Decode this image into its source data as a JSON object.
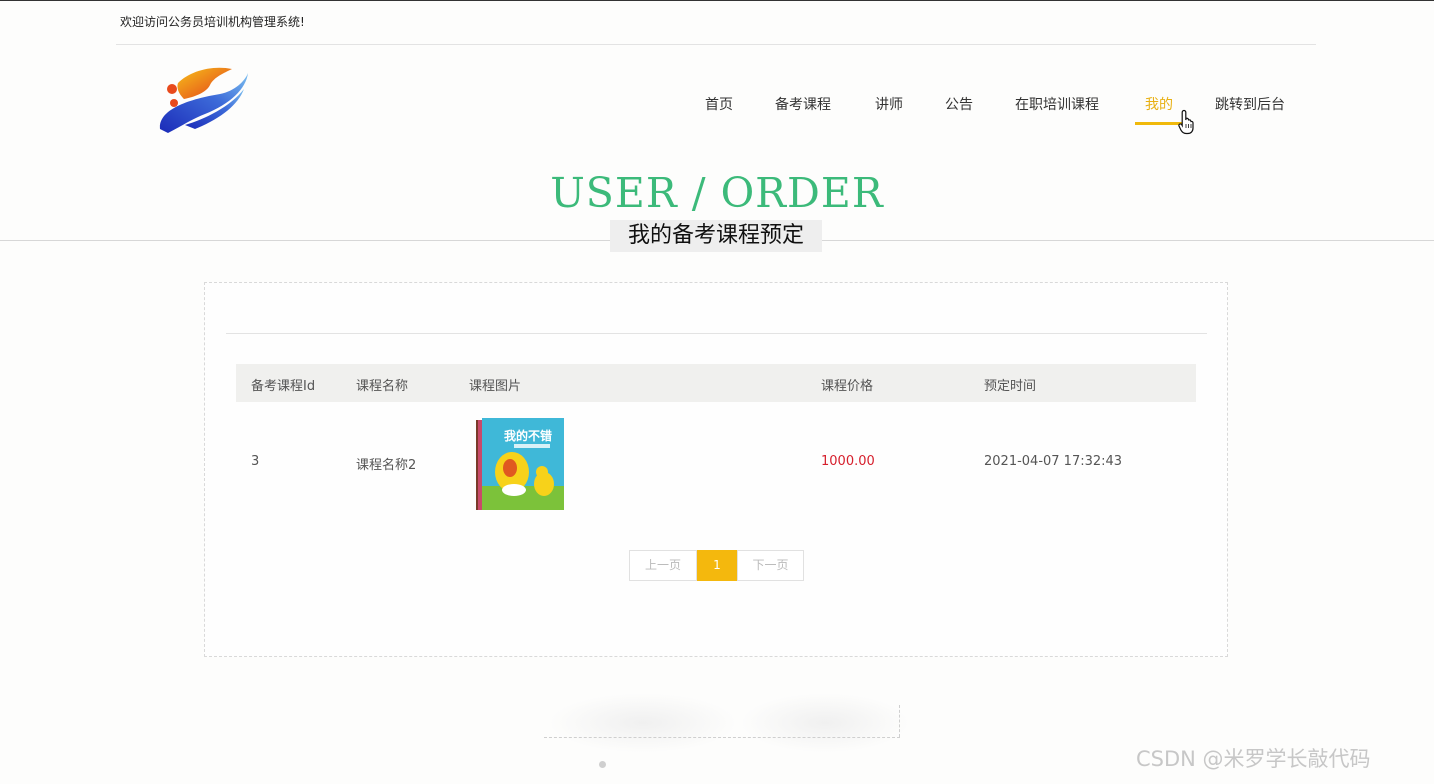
{
  "header": {
    "welcome": "欢迎访问公务员培训机构管理系统!"
  },
  "nav": {
    "items": [
      {
        "label": "首页"
      },
      {
        "label": "备考课程"
      },
      {
        "label": "讲师"
      },
      {
        "label": "公告"
      },
      {
        "label": "在职培训课程"
      },
      {
        "label": "我的",
        "active": true
      },
      {
        "label": "跳转到后台"
      }
    ]
  },
  "hero": {
    "title": "USER / ORDER",
    "subtitle": "我的备考课程预定"
  },
  "table": {
    "headers": [
      "备考课程Id",
      "课程名称",
      "课程图片",
      "课程价格",
      "预定时间"
    ],
    "rows": [
      {
        "id": "3",
        "name": "课程名称2",
        "image": "book-cover-image",
        "price": "1000.00",
        "time": "2021-04-07 17:32:43",
        "image_text": "我的不错"
      }
    ]
  },
  "pagination": {
    "prev": "上一页",
    "current": "1",
    "next": "下一页"
  },
  "watermark": "CSDN @米罗学长敲代码",
  "colors": {
    "accent": "#f4b80d",
    "hero": "#3cba7a",
    "price": "#d61f2c"
  }
}
